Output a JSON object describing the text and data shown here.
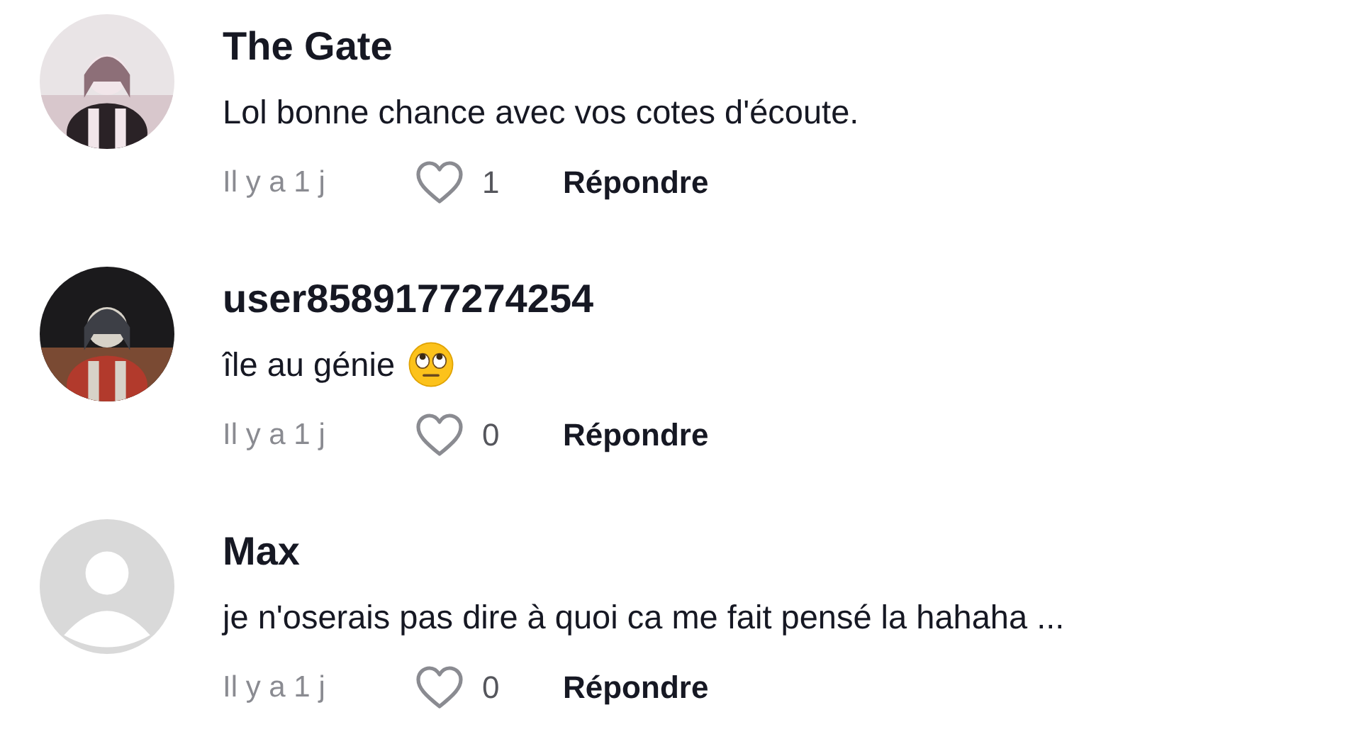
{
  "comments": [
    {
      "author": "The Gate",
      "text": "Lol bonne chance avec vos cotes d'écoute.",
      "emoji": false,
      "time": "Il y a 1 j",
      "liked": false,
      "likes": "1",
      "reply": "Répondre"
    },
    {
      "author": "user8589177274254",
      "text": "île au génie",
      "emoji": true,
      "time": "Il y a 1 j",
      "liked": false,
      "likes": "0",
      "reply": "Répondre"
    },
    {
      "avatar": {
        "kind": "default"
      },
      "author": "Max",
      "text": "je n'oserais pas dire à quoi ca me fait pensé la hahaha ...",
      "emoji": false,
      "time": "Il y a 1 j",
      "liked": false,
      "likes": "0",
      "reply": "Répondre"
    }
  ]
}
